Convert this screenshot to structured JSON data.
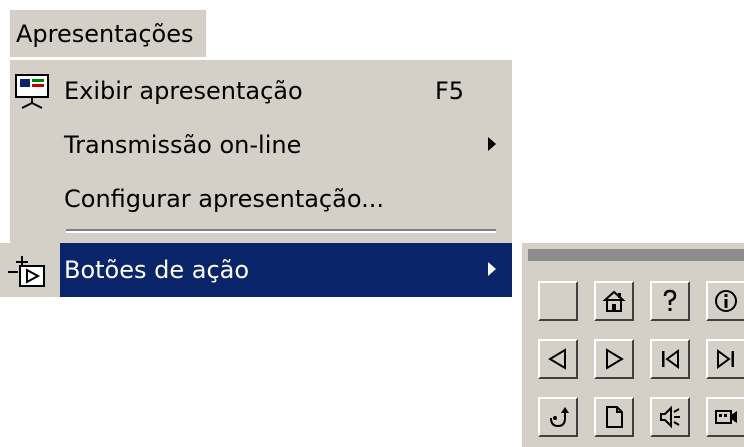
{
  "menu": {
    "title": "Apresentações",
    "items": [
      {
        "label": "Exibir apresentação",
        "shortcut": "F5",
        "icon": "slideshow-icon"
      },
      {
        "label": "Transmissão on-line",
        "icon": "none"
      },
      {
        "label": "Configurar apresentação...",
        "icon": "none"
      },
      {
        "label": "Botões de ação",
        "icon": "action-buttons-icon"
      }
    ]
  },
  "submenu": {
    "buttons": [
      "blank-button-icon",
      "home-icon",
      "help-icon",
      "information-icon",
      "back-previous-icon",
      "forward-next-icon",
      "beginning-icon",
      "end-icon",
      "return-icon",
      "document-icon",
      "sound-icon",
      "movie-icon"
    ]
  },
  "colors": {
    "menu_bg": "#d4d0c8",
    "selection_bg": "#0a246a",
    "selection_text": "#ffffff"
  }
}
